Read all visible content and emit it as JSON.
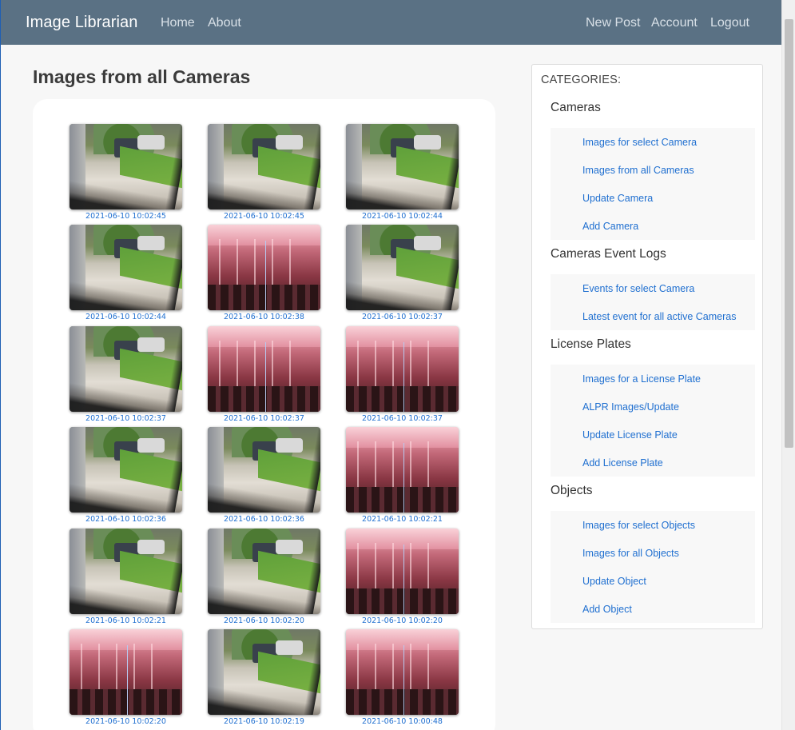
{
  "navbar": {
    "brand": "Image Librarian",
    "left_links": [
      "Home",
      "About"
    ],
    "right_links": [
      "New Post",
      "Account",
      "Logout"
    ],
    "bg_color": "#5a7184"
  },
  "main": {
    "title": "Images from all Cameras",
    "thumbnails": [
      {
        "caption": "2021-06-10 10:02:45",
        "scene": "yard"
      },
      {
        "caption": "2021-06-10 10:02:45",
        "scene": "yard"
      },
      {
        "caption": "2021-06-10 10:02:44",
        "scene": "yard"
      },
      {
        "caption": "2021-06-10 10:02:44",
        "scene": "yard"
      },
      {
        "caption": "2021-06-10 10:02:38",
        "scene": "room"
      },
      {
        "caption": "2021-06-10 10:02:37",
        "scene": "yard"
      },
      {
        "caption": "2021-06-10 10:02:37",
        "scene": "yard"
      },
      {
        "caption": "2021-06-10 10:02:37",
        "scene": "room"
      },
      {
        "caption": "2021-06-10 10:02:37",
        "scene": "room"
      },
      {
        "caption": "2021-06-10 10:02:36",
        "scene": "yard"
      },
      {
        "caption": "2021-06-10 10:02:36",
        "scene": "yard"
      },
      {
        "caption": "2021-06-10 10:02:21",
        "scene": "room"
      },
      {
        "caption": "2021-06-10 10:02:21",
        "scene": "yard"
      },
      {
        "caption": "2021-06-10 10:02:20",
        "scene": "yard"
      },
      {
        "caption": "2021-06-10 10:02:20",
        "scene": "room"
      },
      {
        "caption": "2021-06-10 10:02:20",
        "scene": "room"
      },
      {
        "caption": "2021-06-10 10:02:19",
        "scene": "yard"
      },
      {
        "caption": "2021-06-10 10:00:48",
        "scene": "room"
      }
    ]
  },
  "sidebar": {
    "title": "CATEGORIES:",
    "sections": [
      {
        "title": "Cameras",
        "links": [
          "Images for select Camera",
          "Images from all Cameras",
          "Update Camera",
          "Add Camera"
        ]
      },
      {
        "title": "Cameras Event Logs",
        "links": [
          "Events for select Camera",
          "Latest event for all active Cameras"
        ]
      },
      {
        "title": "License Plates",
        "links": [
          "Images for a License Plate",
          "ALPR Images/Update",
          "Update License Plate",
          "Add License Plate"
        ]
      },
      {
        "title": "Objects",
        "links": [
          "Images for select Objects",
          "Images for all Objects",
          "Update Object",
          "Add Object"
        ]
      }
    ],
    "link_color": "#1f6fd0"
  }
}
